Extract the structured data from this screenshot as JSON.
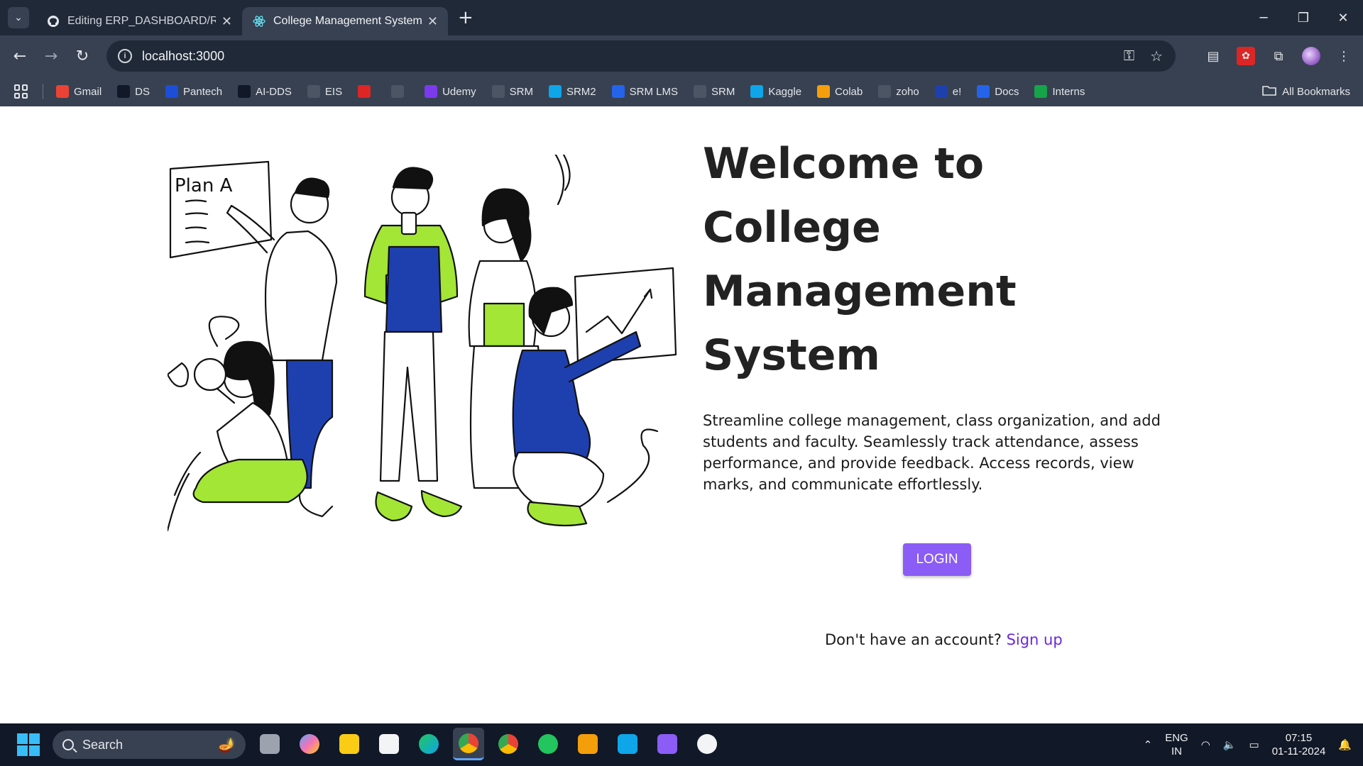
{
  "browser": {
    "tabs": [
      {
        "label": "Editing ERP_DASHBOARD/READ",
        "active": false,
        "icon": "github-icon"
      },
      {
        "label": "College Management System",
        "active": true,
        "icon": "react-icon"
      }
    ],
    "url": "localhost:3000",
    "bookmarks": [
      {
        "label": "Gmail",
        "icon": "gmail-icon",
        "color": "#ea4335"
      },
      {
        "label": "DS",
        "icon": "ds-icon",
        "color": "#111827"
      },
      {
        "label": "Pantech",
        "icon": "pantech-icon",
        "color": "#1d4ed8"
      },
      {
        "label": "AI-DDS",
        "icon": "ai-dds-icon",
        "color": "#111827"
      },
      {
        "label": "EIS",
        "icon": "globe-icon",
        "color": "#4b5563"
      },
      {
        "label": "",
        "icon": "pdf-icon",
        "color": "#dc2626"
      },
      {
        "label": "",
        "icon": "hourglass-icon",
        "color": "#4b5563"
      },
      {
        "label": "Udemy",
        "icon": "udemy-icon",
        "color": "#7c3aed"
      },
      {
        "label": "SRM",
        "icon": "srm-icon",
        "color": "#4b5563"
      },
      {
        "label": "SRM2",
        "icon": "srm2-icon",
        "color": "#0ea5e9"
      },
      {
        "label": "SRM LMS",
        "icon": "srm-lms-icon",
        "color": "#2563eb"
      },
      {
        "label": "SRM",
        "icon": "globe-icon",
        "color": "#4b5563"
      },
      {
        "label": "Kaggle",
        "icon": "kaggle-icon",
        "color": "#0ea5e9"
      },
      {
        "label": "Colab",
        "icon": "colab-icon",
        "color": "#f59e0b"
      },
      {
        "label": "zoho",
        "icon": "zoho-icon",
        "color": "#4b5563"
      },
      {
        "label": "e!",
        "icon": "e-icon",
        "color": "#1e40af"
      },
      {
        "label": "Docs",
        "icon": "docs-icon",
        "color": "#2563eb"
      },
      {
        "label": "Interns",
        "icon": "sheets-icon",
        "color": "#16a34a"
      }
    ],
    "all_bookmarks": "All Bookmarks"
  },
  "page": {
    "title_lines": [
      "Welcome to",
      "College",
      "Management",
      "System"
    ],
    "description": "Streamline college management, class organization, and add students and faculty. Seamlessly track attendance, assess performance, and provide feedback. Access records, view marks, and communicate effortlessly.",
    "login_label": "LOGIN",
    "signup_prompt": "Don't have an account?",
    "signup_link": "Sign up",
    "illustration_note": "Plan A",
    "accent": "#8b5cf6",
    "link_color": "#6d28d9"
  },
  "taskbar": {
    "search_placeholder": "Search",
    "language": [
      "ENG",
      "IN"
    ],
    "time": "07:15",
    "date": "01-11-2024"
  }
}
